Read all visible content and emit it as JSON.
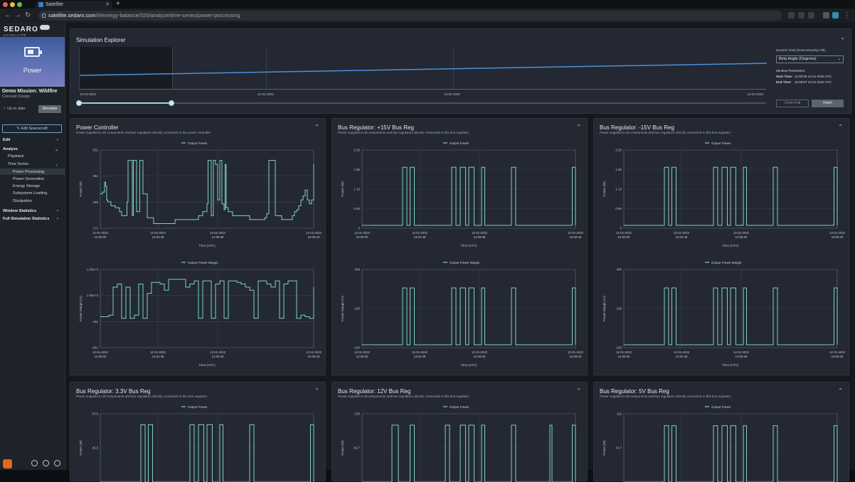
{
  "browser": {
    "tab_title": "Satellite",
    "url_host": "satellite.sedaro.com",
    "url_path": "/#/energy-balance/320/analyze/time-series/power-processing"
  },
  "sidebar": {
    "logo": "SEDARO",
    "logo_sub": "SATELLITE",
    "hero_label": "Power",
    "mission": "Demo Mission: Wildfire",
    "design": "Concept Design",
    "status": "Up to date",
    "simulate": "Simulate",
    "edit_spacecraft": "Edit Spacecraft",
    "nav": [
      {
        "label": "Edit",
        "level": 0,
        "caret": "›"
      },
      {
        "label": "Analyze",
        "level": 0,
        "caret": "⌄"
      },
      {
        "label": "Playback",
        "level": 1,
        "caret": ""
      },
      {
        "label": "Time Series",
        "level": 1,
        "caret": "⌄"
      },
      {
        "label": "Power Processing",
        "level": 2,
        "caret": ""
      },
      {
        "label": "Power Generation",
        "level": 2,
        "caret": ""
      },
      {
        "label": "Energy Storage",
        "level": 2,
        "caret": ""
      },
      {
        "label": "Subsystem Loading",
        "level": 2,
        "caret": ""
      },
      {
        "label": "Dissipation",
        "level": 2,
        "caret": ""
      },
      {
        "label": "Window Statistics",
        "level": 0,
        "caret": "›"
      },
      {
        "label": "Full Simulation Statistics",
        "level": 0,
        "caret": "›"
      }
    ]
  },
  "simulation_explorer": {
    "title": "Simulation Explorer",
    "ticks": [
      "12-01-2022",
      "12-01-2022",
      "12-02-2022",
      "12-02-2022"
    ],
    "explorer_data_label": "Explorer Data (Downsampling 70k)",
    "explorer_data_value": "Beta Angle (Degrees)",
    "window_params": "Window Parameters",
    "start_label": "Start Time:",
    "start_value": "12:00:00 12-01-2022 UTC",
    "end_label": "End Time:",
    "end_value": "16:09:57 12-01-2022 UTC",
    "zoom_full": "Zoom Full",
    "fetch": "Fetch"
  },
  "colors": {
    "trace": "#7fd1c4",
    "accent_blue": "#4a90d9"
  },
  "chart_data": [
    {
      "type": "line",
      "panel": "Power Controller",
      "subtitle": "Power supplied to all components and bus regulators directly connected to the power controller",
      "legend": "Output Power",
      "ylabel": "Power (W)",
      "xlabel": "Time (UTC)",
      "yticks": [
        "531",
        "361",
        "260",
        "171"
      ],
      "xticks": [
        [
          "12-01-2022",
          "12:00:00"
        ],
        [
          "12-01-2022",
          "13:04:48"
        ],
        [
          "12-01-2022",
          "14:09:36"
        ],
        [
          "12-01-2022",
          "16:09:33"
        ]
      ],
      "ylim": [
        171,
        531
      ],
      "x": [
        0,
        0.5,
        1,
        2,
        2.5,
        3,
        3.5,
        4,
        5,
        7,
        8,
        9,
        10,
        12,
        12.5,
        13,
        14,
        15,
        15.5,
        16,
        17,
        18,
        18.5,
        19,
        20,
        21,
        22,
        23,
        25,
        27,
        30,
        33,
        35,
        37,
        40,
        42,
        44,
        46,
        48,
        50,
        50.5,
        51,
        52,
        53,
        54,
        55,
        56,
        57,
        58,
        58.5,
        59,
        60,
        62,
        65,
        70,
        72,
        75,
        77,
        78,
        79,
        80,
        82,
        85,
        88,
        90,
        91,
        92,
        93,
        94,
        95,
        96,
        97,
        98,
        99,
        100
      ],
      "y": [
        330,
        330,
        340,
        390,
        370,
        300,
        290,
        290,
        270,
        260,
        260,
        240,
        220,
        220,
        290,
        500,
        500,
        220,
        500,
        500,
        240,
        240,
        500,
        500,
        330,
        330,
        210,
        210,
        180,
        180,
        180,
        180,
        200,
        200,
        200,
        200,
        200,
        220,
        240,
        280,
        500,
        500,
        220,
        500,
        480,
        300,
        500,
        280,
        250,
        480,
        260,
        240,
        220,
        220,
        200,
        200,
        200,
        210,
        230,
        500,
        500,
        220,
        200,
        200,
        220,
        240,
        250,
        270,
        300,
        320,
        350,
        300,
        280,
        300,
        480
      ],
      "series": []
    },
    {
      "type": "line",
      "panel": "Power Controller",
      "legend": "Output Power Margin",
      "ylabel": "Power Margin (%)",
      "xlabel": "Time (UTC)",
      "yticks": [
        "1.63e+3",
        "1.00e+3",
        "161",
        "-651"
      ],
      "xticks": [
        [
          "12-01-2022",
          "12:00:00"
        ],
        [
          "12-01-2022",
          "13:04:48"
        ],
        [
          "12-01-2022",
          "14:09:36"
        ],
        [
          "12-01-2022",
          "16:09:33"
        ]
      ],
      "ylim": [
        -651,
        1630
      ],
      "x": [
        0,
        2,
        4,
        6,
        8,
        10,
        12,
        14,
        16,
        18,
        20,
        22,
        24,
        26,
        28,
        30,
        32,
        34,
        36,
        38,
        40,
        42,
        44,
        46,
        48,
        50,
        52,
        54,
        56,
        58,
        60,
        62,
        64,
        66,
        68,
        70,
        72,
        74,
        76,
        78,
        80,
        82,
        84,
        86,
        88,
        90,
        92,
        94,
        96,
        98,
        100
      ],
      "y": [
        250,
        250,
        300,
        1200,
        1300,
        200,
        1200,
        200,
        300,
        1300,
        200,
        1000,
        1350,
        1350,
        1300,
        1100,
        1450,
        1450,
        1450,
        1450,
        1200,
        1300,
        1400,
        200,
        1400,
        1400,
        200,
        1300,
        1400,
        200,
        1400,
        1400,
        1350,
        1300,
        1200,
        1100,
        200,
        1400,
        1400,
        1300,
        1200,
        1400,
        200,
        1300,
        1400,
        1400,
        200,
        300,
        250,
        200,
        1200
      ],
      "series": []
    },
    {
      "type": "line",
      "panel": "Bus Regulator: +15V Bus Reg",
      "subtitle": "Power supplied to all components and bus regulators directly connected to this bus regulator",
      "legend": "Output Power",
      "ylabel": "Power (W)",
      "xlabel": "Time (UTC)",
      "yticks": [
        "2.20",
        "1.65",
        "1.10",
        "0.55",
        "0"
      ],
      "xticks": [
        [
          "12-01-2022",
          "12:00:00"
        ],
        [
          "12-01-2022",
          "13:04:48"
        ],
        [
          "12-01-2022",
          "14:09:36"
        ],
        [
          "12-01-2022",
          "16:09:33"
        ]
      ],
      "ylim": [
        0,
        2.2
      ],
      "pulses": [
        [
          19,
          21
        ],
        [
          22.5,
          24.5
        ],
        [
          42,
          44
        ],
        [
          46,
          48.5
        ],
        [
          50,
          52.5
        ],
        [
          56,
          57.5
        ],
        [
          70,
          72
        ],
        [
          98.5,
          100
        ]
      ],
      "high": 1.8,
      "low": 0
    },
    {
      "type": "line",
      "panel": "Bus Regulator: +15V Bus Reg",
      "legend": "Output Power Margin",
      "ylabel": "Power Margin (%)",
      "xlabel": "Time (UTC)",
      "yticks": [
        "400",
        "150",
        "-100"
      ],
      "xticks": [
        [
          "12-01-2022",
          "12:00:00"
        ],
        [
          "12-01-2022",
          "13:04:48"
        ],
        [
          "12-01-2022",
          "14:09:36"
        ],
        [
          "12-01-2022",
          "16:09:33"
        ]
      ],
      "ylim": [
        -100,
        400
      ],
      "pulses": [
        [
          19,
          21
        ],
        [
          22.5,
          24.5
        ],
        [
          42,
          44
        ],
        [
          46,
          48.5
        ],
        [
          50,
          52.5
        ],
        [
          56,
          57.5
        ],
        [
          70,
          72
        ],
        [
          98.5,
          100
        ]
      ],
      "high": 300,
      "low": -100
    },
    {
      "type": "line",
      "panel": "Bus Regulator: -15V Bus Reg",
      "subtitle": "Power supplied to all components and bus regulators directly connected to this bus regulator",
      "legend": "Output Power",
      "ylabel": "Power (W)",
      "xlabel": "Time (UTC)",
      "yticks": [
        "2.20",
        "1.65",
        "1.10",
        "0.55",
        "0"
      ],
      "xticks": [
        [
          "12-01-2022",
          "12:00:00"
        ],
        [
          "12-01-2022",
          "13:04:48"
        ],
        [
          "12-01-2022",
          "14:09:36"
        ],
        [
          "12-01-2022",
          "16:09:33"
        ]
      ],
      "ylim": [
        0,
        2.2
      ],
      "pulses": [
        [
          19,
          21
        ],
        [
          22.5,
          24.5
        ],
        [
          42,
          44
        ],
        [
          46,
          48.5
        ],
        [
          50,
          52.5
        ],
        [
          56,
          57.5
        ],
        [
          70,
          72
        ],
        [
          98.5,
          100
        ]
      ],
      "high": 1.8,
      "low": 0
    },
    {
      "type": "line",
      "panel": "Bus Regulator: -15V Bus Reg",
      "legend": "Output Power Margin",
      "ylabel": "Power Margin (%)",
      "xlabel": "Time (UTC)",
      "yticks": [
        "400",
        "150",
        "-100"
      ],
      "xticks": [
        [
          "12-01-2022",
          "12:00:00"
        ],
        [
          "12-01-2022",
          "13:04:48"
        ],
        [
          "12-01-2022",
          "14:09:36"
        ],
        [
          "12-01-2022",
          "16:09:33"
        ]
      ],
      "ylim": [
        -100,
        400
      ],
      "pulses": [
        [
          19,
          21
        ],
        [
          22.5,
          24.5
        ],
        [
          42,
          44
        ],
        [
          46,
          48.5
        ],
        [
          50,
          52.5
        ],
        [
          56,
          57.5
        ],
        [
          70,
          72
        ],
        [
          98.5,
          100
        ]
      ],
      "high": 300,
      "low": -100
    },
    {
      "type": "line",
      "panel": "Bus Regulator: 3.3V Bus Reg",
      "subtitle": "Power supplied to all components and bus regulators directly connected to this bus regulator",
      "legend": "Output Power",
      "ylabel": "Power (W)",
      "yticks": [
        "53.0",
        "35.3"
      ],
      "ylim": [
        0,
        53
      ],
      "pulses": [
        [
          19,
          21
        ],
        [
          22.5,
          24.5
        ],
        [
          42,
          44
        ],
        [
          46,
          48.5
        ],
        [
          50,
          52.5
        ],
        [
          56,
          57.5
        ],
        [
          70,
          72
        ],
        [
          98.5,
          100
        ]
      ],
      "high": 48,
      "low": 0
    },
    {
      "type": "line",
      "panel": "Bus Regulator: 12V Bus Reg",
      "subtitle": "Power supplied to all components and bus regulators directly connected to this bus regulator",
      "legend": "Output Power",
      "ylabel": "Power (W)",
      "yticks": [
        "100",
        "66.7"
      ],
      "ylim": [
        0,
        100
      ],
      "pulses": [
        [
          14,
          17
        ],
        [
          22.5,
          24.5
        ],
        [
          39,
          41
        ],
        [
          46,
          48.5
        ],
        [
          50,
          52.5
        ],
        [
          56,
          57.5
        ],
        [
          70,
          72
        ],
        [
          88,
          89
        ],
        [
          98.5,
          100
        ]
      ],
      "high": 90,
      "low": 0
    },
    {
      "type": "line",
      "panel": "Bus Regulator: 5V Bus Reg",
      "subtitle": "Power supplied to all components and bus regulators directly connected to this bus regulator",
      "legend": "Output Power",
      "ylabel": "Power (W)",
      "yticks": [
        "112",
        "74.7"
      ],
      "ylim": [
        0,
        112
      ],
      "pulses": [
        [
          19,
          21
        ],
        [
          22.5,
          24.5
        ],
        [
          42,
          44
        ],
        [
          46,
          48.5
        ],
        [
          50,
          52.5
        ],
        [
          56,
          57.5
        ],
        [
          70,
          72
        ],
        [
          98.5,
          100
        ]
      ],
      "high": 100,
      "low": 0
    }
  ]
}
